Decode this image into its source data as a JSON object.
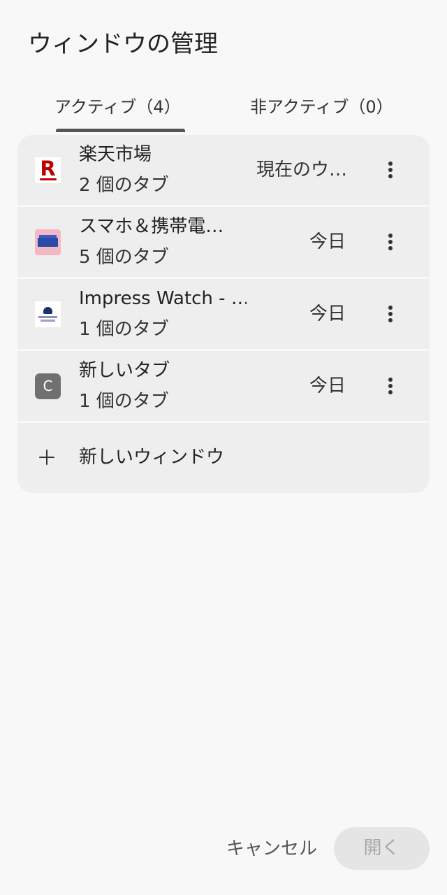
{
  "dialog": {
    "title": "ウィンドウの管理"
  },
  "tabs": {
    "active_label": "アクティブ（4）",
    "inactive_label": "非アクティブ（0）"
  },
  "windows": [
    {
      "title": "楽天市場",
      "subtitle": "2 個のタブ",
      "time": "現在のウ…",
      "icon": "rakuten-r-icon"
    },
    {
      "title": "スマホ＆携帯電…",
      "subtitle": "5 個のタブ",
      "time": "今日",
      "icon": "ketai-watch-icon"
    },
    {
      "title": "Impress Watch - …",
      "subtitle": "1 個のタブ",
      "time": "今日",
      "icon": "impress-watch-icon"
    },
    {
      "title": "新しいタブ",
      "subtitle": "1 個のタブ",
      "time": "今日",
      "icon": "letter-c-icon",
      "icon_letter": "C"
    }
  ],
  "new_window": {
    "label": "新しいウィンドウ"
  },
  "actions": {
    "cancel_label": "キャンセル",
    "open_label": "開く"
  },
  "colors": {
    "background": "#f8f8f8",
    "row_background": "#eeeeee",
    "tab_indicator": "#555555",
    "disabled_button_bg": "#e5e5e5",
    "disabled_button_text": "#a8a8a8"
  }
}
